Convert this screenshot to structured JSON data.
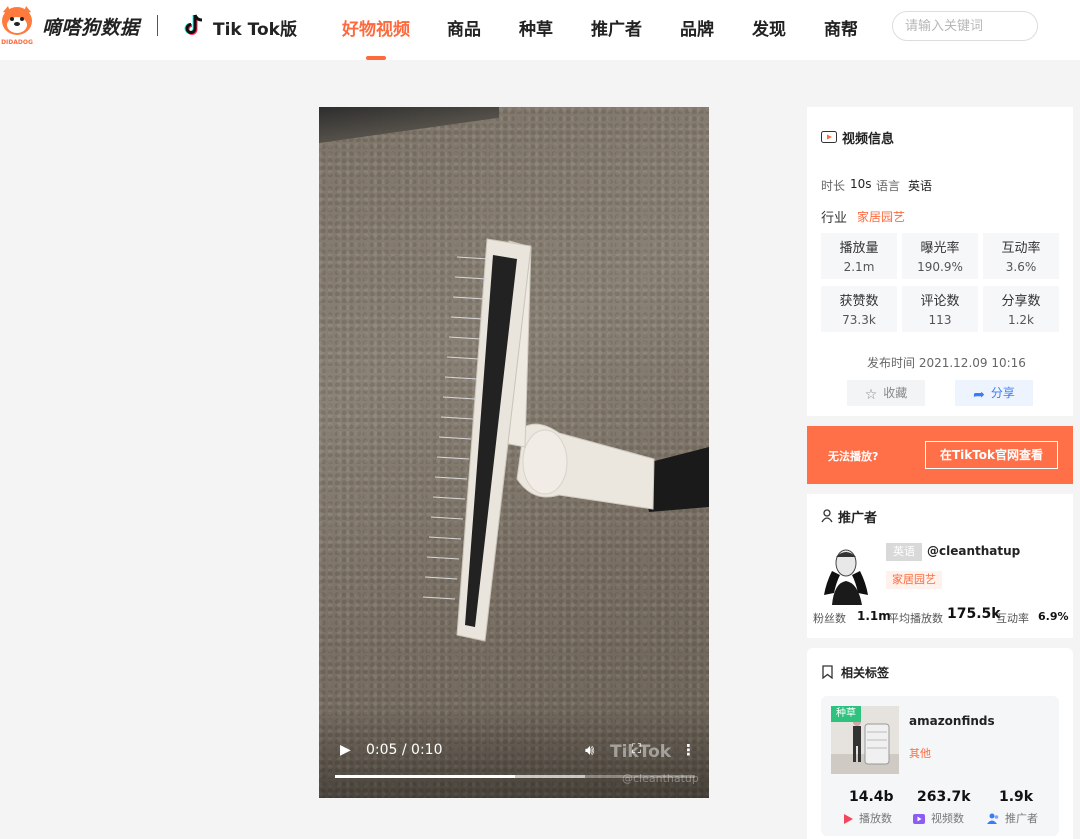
{
  "header": {
    "brand": "嘀嗒狗数据",
    "platform": "Tik Tok版",
    "nav": [
      "好物视频",
      "商品",
      "种草",
      "推广者",
      "品牌",
      "发现",
      "商帮"
    ],
    "active_nav": "好物视频",
    "search_placeholder": "请输入关键词",
    "colors": {
      "accent": "#ff6a3d"
    }
  },
  "player": {
    "current_time": "0:05",
    "duration": "0:10",
    "time_display": "0:05 / 0:10",
    "progress_fraction": 0.5,
    "watermark": "TikTok",
    "watermark_handle": "@cleanthatup"
  },
  "video_info": {
    "title": "视频信息",
    "duration_label": "时长",
    "duration_value": "10s",
    "language_label": "语言",
    "language_value": "英语",
    "industry_label": "行业",
    "industry_value": "家居园艺",
    "stats": [
      {
        "label": "播放量",
        "value": "2.1m"
      },
      {
        "label": "曝光率",
        "value": "190.9%"
      },
      {
        "label": "互动率",
        "value": "3.6%"
      },
      {
        "label": "获赞数",
        "value": "73.3k"
      },
      {
        "label": "评论数",
        "value": "113"
      },
      {
        "label": "分享数",
        "value": "1.2k"
      }
    ],
    "publish_time": "发布时间 2021.12.09 10:16",
    "favorite_label": "收藏",
    "share_label": "分享"
  },
  "banner": {
    "text": "无法播放?",
    "button": "在TikTok官网查看"
  },
  "promoter": {
    "title": "推广者",
    "language_tag": "英语",
    "handle": "@cleanthatup",
    "category": "家居园艺",
    "fans_label": "粉丝数",
    "fans_value": "1.1m",
    "avg_play_label": "平均播放数",
    "avg_play_value": "175.5k",
    "engagement_label": "互动率",
    "engagement_value": "6.9%"
  },
  "tags": {
    "title": "相关标签",
    "badge": "种草",
    "name": "amazonfinds",
    "type": "其他",
    "play_count": "14.4b",
    "play_label": "播放数",
    "video_count": "263.7k",
    "video_label": "视频数",
    "promoter_count": "1.9k",
    "promoter_label": "推广者"
  }
}
